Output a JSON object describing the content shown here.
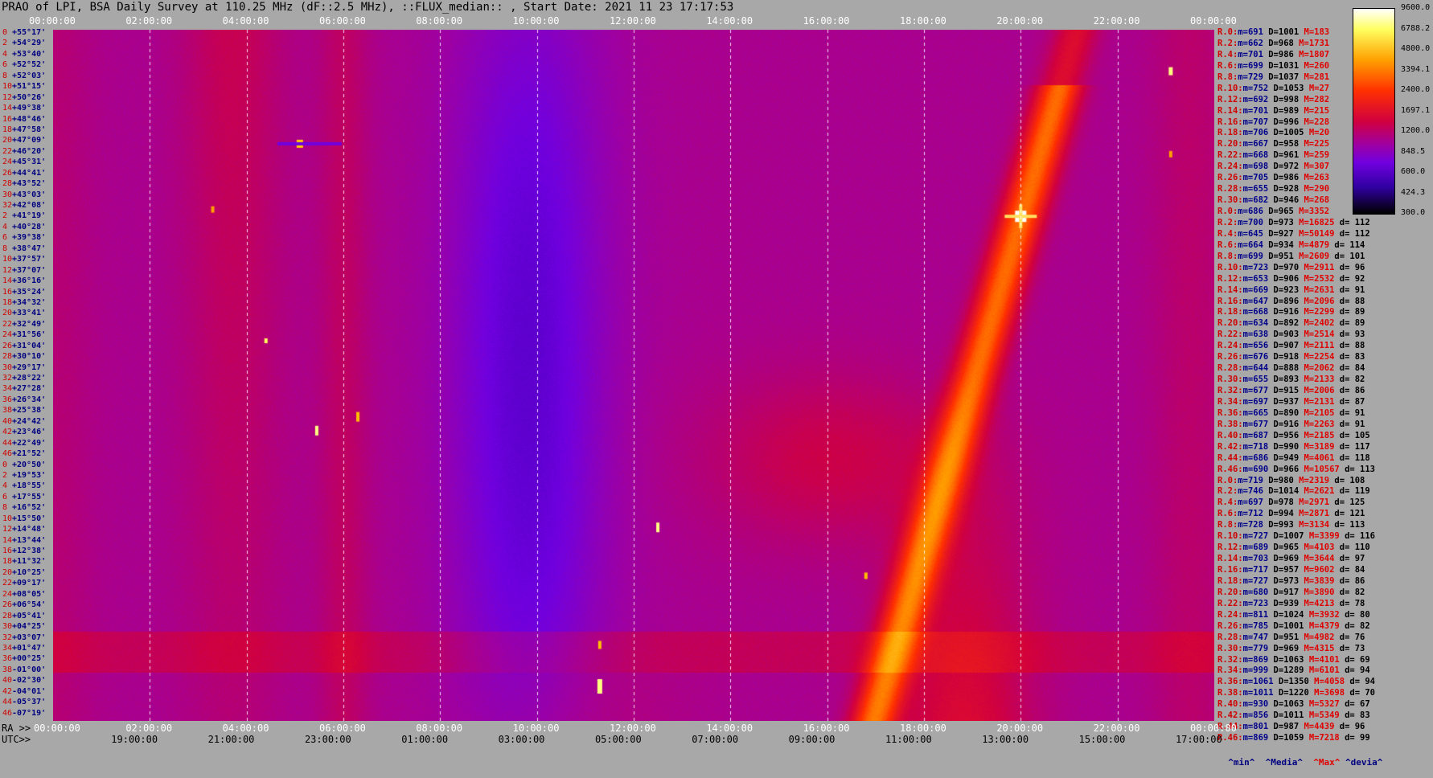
{
  "title": "PRAO of LPI, BSA Daily Survey at 110.25 MHz (dF::2.5 MHz), ::FLUX_median:: , Start Date: 2021 11 23 17:17:53",
  "top_axis_ticks": [
    "00:00:00",
    "02:00:00",
    "04:00:00",
    "06:00:00",
    "08:00:00",
    "10:00:00",
    "12:00:00",
    "14:00:00",
    "16:00:00",
    "18:00:00",
    "20:00:00",
    "22:00:00",
    "00:00:00"
  ],
  "ra_axis": {
    "label": "RA >>",
    "ticks": [
      "00:00:00",
      "02:00:00",
      "04:00:00",
      "06:00:00",
      "08:00:00",
      "10:00:00",
      "12:00:00",
      "14:00:00",
      "16:00:00",
      "18:00:00",
      "20:00:00",
      "22:00:00",
      "00:00:00"
    ]
  },
  "utc_axis": {
    "label": "UTC>>",
    "ticks": [
      "19:00:00",
      "21:00:00",
      "23:00:00",
      "01:00:00",
      "03:00:00",
      "05:00:00",
      "07:00:00",
      "09:00:00",
      "11:00:00",
      "13:00:00",
      "15:00:00",
      "17:00:00"
    ]
  },
  "colorbar_ticks": [
    "9600.0",
    "6788.2",
    "4800.0",
    "3394.1",
    "2400.0",
    "1697.1",
    "1200.0",
    "848.5",
    "600.0",
    "424.3",
    "300.0"
  ],
  "declinations": [
    [
      "0",
      "+55°17'"
    ],
    [
      "2",
      "+54°29'"
    ],
    [
      "4",
      "+53°40'"
    ],
    [
      "6",
      "+52°52'"
    ],
    [
      "8",
      "+52°03'"
    ],
    [
      "10",
      "+51°15'"
    ],
    [
      "12",
      "+50°26'"
    ],
    [
      "14",
      "+49°38'"
    ],
    [
      "16",
      "+48°46'"
    ],
    [
      "18",
      "+47°58'"
    ],
    [
      "20",
      "+47°09'"
    ],
    [
      "22",
      "+46°20'"
    ],
    [
      "24",
      "+45°31'"
    ],
    [
      "26",
      "+44°41'"
    ],
    [
      "28",
      "+43°52'"
    ],
    [
      "30",
      "+43°03'"
    ],
    [
      "32",
      "+42°08'"
    ],
    [
      "2",
      "+41°19'"
    ],
    [
      "4",
      "+40°28'"
    ],
    [
      "6",
      "+39°38'"
    ],
    [
      "8",
      "+38°47'"
    ],
    [
      "10",
      "+37°57'"
    ],
    [
      "12",
      "+37°07'"
    ],
    [
      "14",
      "+36°16'"
    ],
    [
      "16",
      "+35°24'"
    ],
    [
      "18",
      "+34°32'"
    ],
    [
      "20",
      "+33°41'"
    ],
    [
      "22",
      "+32°49'"
    ],
    [
      "24",
      "+31°56'"
    ],
    [
      "26",
      "+31°04'"
    ],
    [
      "28",
      "+30°10'"
    ],
    [
      "30",
      "+29°17'"
    ],
    [
      "32",
      "+28°22'"
    ],
    [
      "34",
      "+27°28'"
    ],
    [
      "36",
      "+26°34'"
    ],
    [
      "38",
      "+25°38'"
    ],
    [
      "40",
      "+24°42'"
    ],
    [
      "42",
      "+23°46'"
    ],
    [
      "44",
      "+22°49'"
    ],
    [
      "46",
      "+21°52'"
    ],
    [
      "0",
      "+20°50'"
    ],
    [
      "2",
      "+19°53'"
    ],
    [
      "4",
      "+18°55'"
    ],
    [
      "6",
      "+17°55'"
    ],
    [
      "8",
      "+16°52'"
    ],
    [
      "10",
      "+15°50'"
    ],
    [
      "12",
      "+14°48'"
    ],
    [
      "14",
      "+13°44'"
    ],
    [
      "16",
      "+12°38'"
    ],
    [
      "18",
      "+11°32'"
    ],
    [
      "20",
      "+10°25'"
    ],
    [
      "22",
      "+09°17'"
    ],
    [
      "24",
      "+08°05'"
    ],
    [
      "26",
      "+06°54'"
    ],
    [
      "28",
      "+05°41'"
    ],
    [
      "30",
      "+04°25'"
    ],
    [
      "32",
      "+03°07'"
    ],
    [
      "34",
      "+01°47'"
    ],
    [
      "36",
      "+00°25'"
    ],
    [
      "38",
      "-01°00'"
    ],
    [
      "40",
      "-02°30'"
    ],
    [
      "42",
      "-04°01'"
    ],
    [
      "44",
      "-05°37'"
    ],
    [
      "46",
      "-07°19'"
    ]
  ],
  "stats": [
    [
      "R.0:",
      "m=691",
      "D=1001",
      "M=183",
      ""
    ],
    [
      "R.2:",
      "m=662",
      "D=968",
      "M=1731",
      ""
    ],
    [
      "R.4:",
      "m=701",
      "D=986",
      "M=1807",
      ""
    ],
    [
      "R.6:",
      "m=699",
      "D=1031",
      "M=260",
      ""
    ],
    [
      "R.8:",
      "m=729",
      "D=1037",
      "M=281",
      ""
    ],
    [
      "R.10:",
      "m=752",
      "D=1053",
      "M=27",
      ""
    ],
    [
      "R.12:",
      "m=692",
      "D=998",
      "M=282",
      ""
    ],
    [
      "R.14:",
      "m=701",
      "D=989",
      "M=215",
      ""
    ],
    [
      "R.16:",
      "m=707",
      "D=996",
      "M=228",
      ""
    ],
    [
      "R.18:",
      "m=706",
      "D=1005",
      "M=20",
      ""
    ],
    [
      "R.20:",
      "m=667",
      "D=958",
      "M=225",
      ""
    ],
    [
      "R.22:",
      "m=668",
      "D=961",
      "M=259",
      ""
    ],
    [
      "R.24:",
      "m=698",
      "D=972",
      "M=307",
      ""
    ],
    [
      "R.26:",
      "m=705",
      "D=986",
      "M=263",
      ""
    ],
    [
      "R.28:",
      "m=655",
      "D=928",
      "M=290",
      ""
    ],
    [
      "R.30:",
      "m=682",
      "D=946",
      "M=268",
      ""
    ],
    [
      "R.0:",
      "m=686",
      "D=965",
      "M=3352",
      ""
    ],
    [
      "R.2:",
      "m=700",
      "D=973",
      "M=16825",
      "d= 112"
    ],
    [
      "R.4:",
      "m=645",
      "D=927",
      "M=50149",
      "d= 112"
    ],
    [
      "R.6:",
      "m=664",
      "D=934",
      "M=4879",
      "d= 114"
    ],
    [
      "R.8:",
      "m=699",
      "D=951",
      "M=2609",
      "d= 101"
    ],
    [
      "R.10:",
      "m=723",
      "D=970",
      "M=2911",
      "d= 96"
    ],
    [
      "R.12:",
      "m=653",
      "D=906",
      "M=2532",
      "d= 92"
    ],
    [
      "R.14:",
      "m=669",
      "D=923",
      "M=2631",
      "d= 91"
    ],
    [
      "R.16:",
      "m=647",
      "D=896",
      "M=2096",
      "d= 88"
    ],
    [
      "R.18:",
      "m=668",
      "D=916",
      "M=2299",
      "d= 89"
    ],
    [
      "R.20:",
      "m=634",
      "D=892",
      "M=2402",
      "d= 89"
    ],
    [
      "R.22:",
      "m=638",
      "D=903",
      "M=2514",
      "d= 93"
    ],
    [
      "R.24:",
      "m=656",
      "D=907",
      "M=2111",
      "d= 88"
    ],
    [
      "R.26:",
      "m=676",
      "D=918",
      "M=2254",
      "d= 83"
    ],
    [
      "R.28:",
      "m=644",
      "D=888",
      "M=2062",
      "d= 84"
    ],
    [
      "R.30:",
      "m=655",
      "D=893",
      "M=2133",
      "d= 82"
    ],
    [
      "R.32:",
      "m=677",
      "D=915",
      "M=2006",
      "d= 86"
    ],
    [
      "R.34:",
      "m=697",
      "D=937",
      "M=2131",
      "d= 87"
    ],
    [
      "R.36:",
      "m=665",
      "D=890",
      "M=2105",
      "d= 91"
    ],
    [
      "R.38:",
      "m=677",
      "D=916",
      "M=2263",
      "d= 91"
    ],
    [
      "R.40:",
      "m=687",
      "D=956",
      "M=2185",
      "d= 105"
    ],
    [
      "R.42:",
      "m=718",
      "D=990",
      "M=3189",
      "d= 117"
    ],
    [
      "R.44:",
      "m=686",
      "D=949",
      "M=4061",
      "d= 118"
    ],
    [
      "R.46:",
      "m=690",
      "D=966",
      "M=10567",
      "d= 113"
    ],
    [
      "R.0:",
      "m=719",
      "D=980",
      "M=2319",
      "d= 108"
    ],
    [
      "R.2:",
      "m=746",
      "D=1014",
      "M=2621",
      "d= 119"
    ],
    [
      "R.4:",
      "m=697",
      "D=978",
      "M=2971",
      "d= 125"
    ],
    [
      "R.6:",
      "m=712",
      "D=994",
      "M=2871",
      "d= 121"
    ],
    [
      "R.8:",
      "m=728",
      "D=993",
      "M=3134",
      "d= 113"
    ],
    [
      "R.10:",
      "m=727",
      "D=1007",
      "M=3399",
      "d= 116"
    ],
    [
      "R.12:",
      "m=689",
      "D=965",
      "M=4103",
      "d= 110"
    ],
    [
      "R.14:",
      "m=703",
      "D=969",
      "M=3644",
      "d= 97"
    ],
    [
      "R.16:",
      "m=717",
      "D=957",
      "M=9602",
      "d= 84"
    ],
    [
      "R.18:",
      "m=727",
      "D=973",
      "M=3839",
      "d= 86"
    ],
    [
      "R.20:",
      "m=680",
      "D=917",
      "M=3890",
      "d= 82"
    ],
    [
      "R.22:",
      "m=723",
      "D=939",
      "M=4213",
      "d= 78"
    ],
    [
      "R.24:",
      "m=811",
      "D=1024",
      "M=3932",
      "d= 80"
    ],
    [
      "R.26:",
      "m=785",
      "D=1001",
      "M=4379",
      "d= 82"
    ],
    [
      "R.28:",
      "m=747",
      "D=951",
      "M=4982",
      "d= 76"
    ],
    [
      "R.30:",
      "m=779",
      "D=969",
      "M=4315",
      "d= 73"
    ],
    [
      "R.32:",
      "m=869",
      "D=1063",
      "M=4101",
      "d= 69"
    ],
    [
      "R.34:",
      "m=999",
      "D=1289",
      "M=6101",
      "d= 94"
    ],
    [
      "R.36:",
      "m=1061",
      "D=1350",
      "M=4058",
      "d= 94"
    ],
    [
      "R.38:",
      "m=1011",
      "D=1220",
      "M=3698",
      "d= 70"
    ],
    [
      "R.40:",
      "m=930",
      "D=1063",
      "M=5327",
      "d= 67"
    ],
    [
      "R.42:",
      "m=856",
      "D=1011",
      "M=5349",
      "d= 83"
    ],
    [
      "R.44:",
      "m=801",
      "D=987",
      "M=4439",
      "d= 96"
    ],
    [
      "R.46:",
      "m=869",
      "D=1059",
      "M=7218",
      "d= 99"
    ]
  ],
  "legend_bar": {
    "min": "^min^",
    "median": "^Media^",
    "max": "^Max^",
    "dev": "^devia^"
  },
  "chart_data": {
    "type": "heatmap",
    "title": "PRAO of LPI, BSA Daily Survey at 110.25 MHz (dF::2.5 MHz), ::FLUX_median:: , Start Date: 2021 11 23 17:17:53",
    "xlabel": "RA",
    "ylabel": "",
    "x_range": [
      "00:00:00",
      "24:00:00"
    ],
    "y_range": [
      "+55°17'",
      "-07°19'"
    ],
    "colorbar": {
      "min": 300.0,
      "max": 9600.0,
      "scale": "log"
    },
    "grid": true,
    "bright_sources_ra_hours": [
      5.1,
      11.3,
      20.0,
      23.1
    ],
    "features": [
      "broad dip near RA 09h-11h",
      "galactic plane ridge from RA ~18h to ~21h",
      "bright source near RA 20h, Dec +41°"
    ]
  },
  "colors": {
    "bg": "#a8a8a8",
    "label_blue": "#000080",
    "label_red": "#d00000"
  }
}
